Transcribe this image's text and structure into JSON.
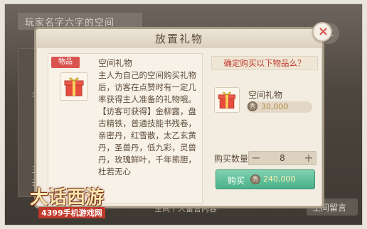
{
  "background": {
    "title": "玩家名字六字的空间",
    "left_labels": [
      "名",
      "主",
      "共"
    ],
    "bottom_text": "空间个人留言内容",
    "right_button": "空间留言"
  },
  "dialog": {
    "title": "放置礼物",
    "close_symbol": "×"
  },
  "left_panel": {
    "tag": "物品",
    "item_name": "空间礼物",
    "description": [
      "主人为自己的空间购买礼物后，访客在点赞时有一定几率获得主人准备的礼物哦。",
      "【访客可获得】金柳露，盘古精铁，普通技能书残卷，亲密丹，红雪散，太乙玄黄丹，圣兽丹，低九彩，灵兽丹，玫瑰鲜叶，千年熊胆，杜若无心"
    ]
  },
  "right_panel": {
    "confirm_text": "确定购买以下物品么？",
    "item_name": "空间礼物",
    "price": "30,000",
    "qty_label": "购买数量",
    "qty_minus": "−",
    "qty_value": "8",
    "qty_plus": "+",
    "buy_label": "购买",
    "buy_price": "240,000",
    "coin_symbol": "秀"
  },
  "logo": {
    "title": "大话西游",
    "subtitle": "4399手机游戏网"
  }
}
